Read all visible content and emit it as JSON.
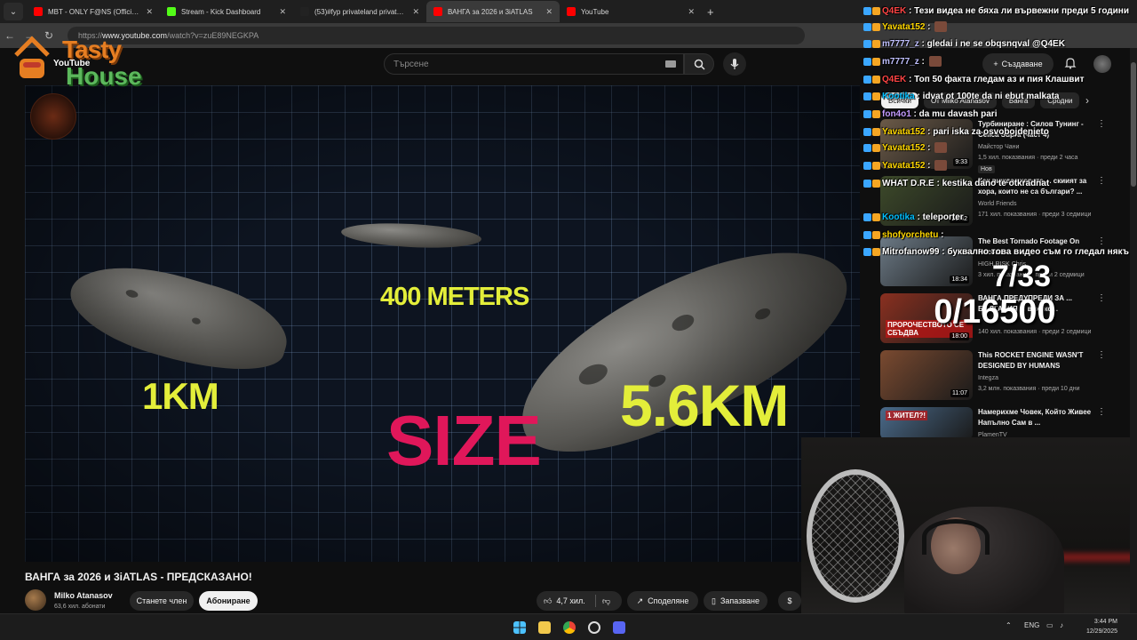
{
  "browser": {
    "tabs": [
      {
        "title": "MBT - ONLY F@NS (Official Au",
        "color": "#ff0000"
      },
      {
        "title": "Stream - Kick Dashboard",
        "color": "#53fc18"
      },
      {
        "title": "(53)#fyp privateland private ru",
        "color": "#222222"
      },
      {
        "title": "ВАНГА за 2026 и 3iATLAS",
        "color": "#ff0000"
      },
      {
        "title": "YouTube",
        "color": "#ff0000"
      }
    ],
    "url_prefix": "https://",
    "url_domain": "www.youtube.com",
    "url_path": "/watch?v=zuE89NEGKPA"
  },
  "youtube": {
    "logo_text": "YouTube",
    "search_placeholder": "Търсене",
    "create_label": "Създаване",
    "chips": [
      "Всички",
      "От Milko Atanasov",
      "Ванга",
      "Сродни"
    ],
    "video": {
      "labels": {
        "small": "1KM",
        "mid": "400 METERS",
        "big": "5.6KM",
        "headline": "SIZE"
      }
    },
    "video_title": "ВАНГА за 2026 и 3iATLAS - ПРЕДСКАЗАНО!",
    "channel_name": "Milko Atanasov",
    "channel_subs": "63,6 хил. абонати",
    "member_label": "Станете член",
    "subscribe_label": "Абониране",
    "likes": "4,7 хил.",
    "share_label": "Споделяне",
    "save_label": "Запазване",
    "recommendations": [
      {
        "title": "Турбиниране : Силов Тунинг - Celica Supra (част 4)",
        "channel": "Майстор Чани",
        "meta": "1,5 хил. показвания · преди 2 часа",
        "badge": "Нов",
        "duration": "9:33",
        "thumb": "#6b5a48"
      },
      {
        "title": "Как виждат хората ... скиият за хора, които не са българи? ...",
        "channel": "World Friends",
        "meta": "171 хил. показвания · преди 3 седмици",
        "badge": "",
        "duration": "20:42",
        "thumb": "#3d4a2a"
      },
      {
        "title": "The Best Tornado Footage On Record",
        "channel": "HIGH RISK Chris",
        "meta": "3 хил. показвания · преди 2 седмици",
        "badge": "",
        "duration": "18:34",
        "thumb": "#6c7a86"
      },
      {
        "title": "ВАНГА ПРЕДУПРЕДИ ЗА ... БЪЛГАРИЯ ... всичко...",
        "channel": "",
        "meta": "140 хил. показвания · преди 2 седмици",
        "badge": "",
        "duration": "18:00",
        "thumb": "#8a3020",
        "thumb_text": "ПРОРОЧЕСТВОТО СЕ СБЪДВА"
      },
      {
        "title": "This ROCKET ENGINE WASN'T DESIGNED BY HUMANS",
        "channel": "Integza",
        "meta": "3,2 млн. показвания · преди 10 дни",
        "badge": "",
        "duration": "11:07",
        "thumb": "#7a4a30"
      },
      {
        "title": "Намерихме Човек, Който Живее Напълно Сам в ...",
        "channel": "PlamenTV",
        "meta": "",
        "badge": "",
        "duration": "",
        "thumb": "#4a6a8a",
        "thumb_text": "1 ЖИТЕЛ?!"
      }
    ]
  },
  "overlay": {
    "logo_tasty": "Tasty",
    "logo_house": "House",
    "counter_top": "7/33",
    "counter_bottom": "0/16500"
  },
  "chat": [
    {
      "user": "Q4EK",
      "user_color": "#ff4444",
      "text": "Тези видеа не бяха ли вървежни преди 5 години"
    },
    {
      "user": "Yavata152",
      "user_color": "#ffd700",
      "text": "",
      "emote": true
    },
    {
      "user": "m7777_z",
      "user_color": "#c0c0ff",
      "text": "gledai i ne se obqsnqval @Q4EK"
    },
    {
      "user": "m7777_z",
      "user_color": "#c0c0ff",
      "text": "",
      "emote": true
    },
    {
      "user": "Q4EK",
      "user_color": "#ff4444",
      "text": "Топ 50 факта гледам аз и пия Клашвит"
    },
    {
      "user": "Kootika",
      "user_color": "#00bfff",
      "text": "idvat ot 100te da ni ebut malkata"
    },
    {
      "user": "fon4o1",
      "user_color": "#c39bff",
      "text": "da mu davash pari"
    },
    {
      "user": "Yavata152",
      "user_color": "#ffd700",
      "text": "pari iska za osvobojdenieto"
    },
    {
      "user": "Yavata152",
      "user_color": "#ffd700",
      "text": "",
      "emote": true
    },
    {
      "user": "Yavata152",
      "user_color": "#ffd700",
      "text": "",
      "emote": true
    },
    {
      "user": "WHAT D.R.E",
      "user_color": "#ffffff",
      "text": "kestika dano te otkradnat"
    },
    {
      "user": "Kootika",
      "user_color": "#00bfff",
      "text": "teleporter"
    },
    {
      "user": "shofyorchetu",
      "user_color": "#ffd700",
      "text": ""
    },
    {
      "user": "Mitrofanow99",
      "user_color": "#ffffff",
      "text": "буквално това видео съм го гледал някъ"
    }
  ],
  "taskbar": {
    "lang": "ENG",
    "time": "3:44 PM",
    "date": "12/29/2025"
  }
}
